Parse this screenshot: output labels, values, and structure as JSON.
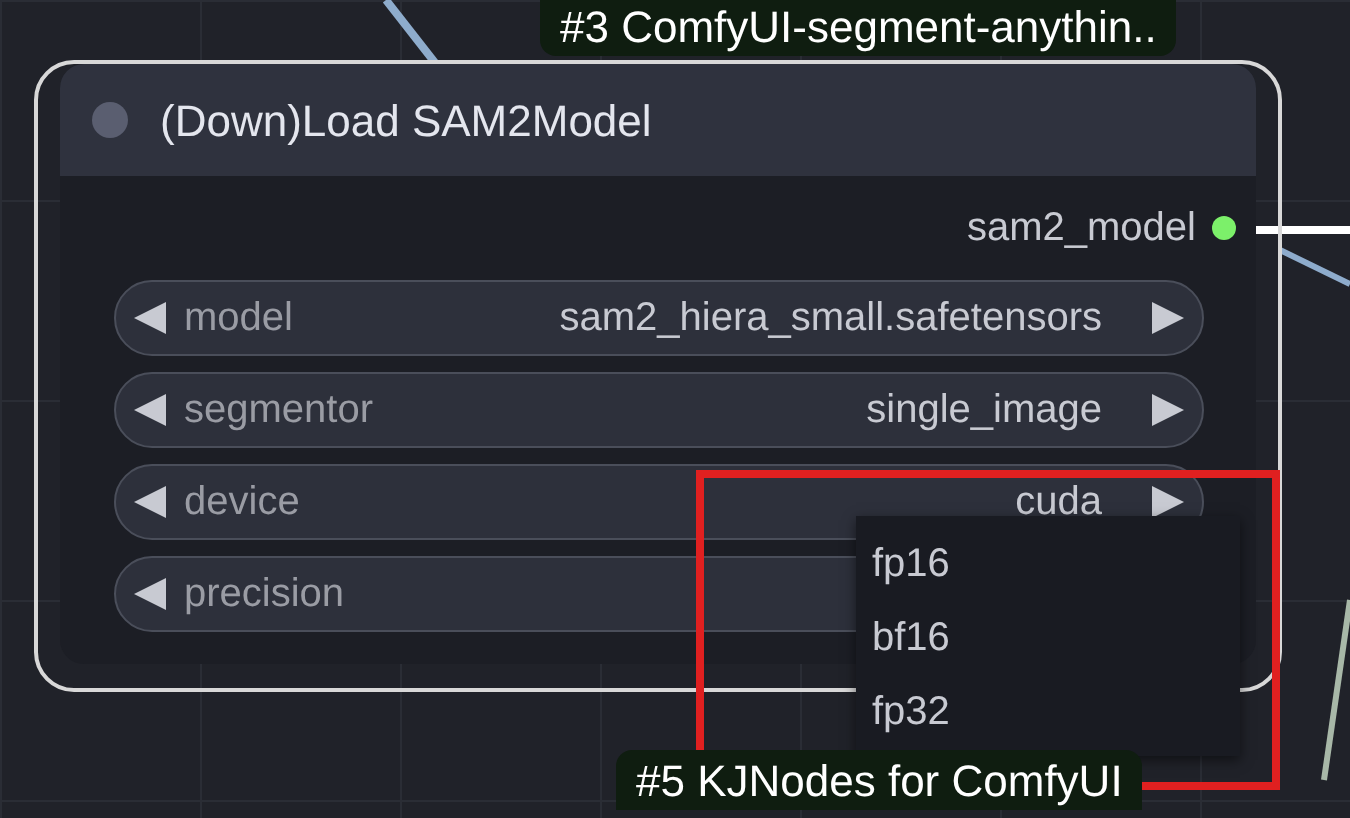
{
  "node": {
    "badge": "#3 ComfyUI-segment-anythin..",
    "title": "(Down)Load SAM2Model",
    "outputs": [
      {
        "label": "sam2_model"
      }
    ],
    "widgets": [
      {
        "label": "model",
        "value": "sam2_hiera_small.safetensors"
      },
      {
        "label": "segmentor",
        "value": "single_image"
      },
      {
        "label": "device",
        "value": "cuda"
      },
      {
        "label": "precision"
      }
    ]
  },
  "dropdown": {
    "options": [
      "fp16",
      "bf16",
      "fp32"
    ]
  },
  "other_node": {
    "badge": "#5 KJNodes for ComfyUI"
  }
}
